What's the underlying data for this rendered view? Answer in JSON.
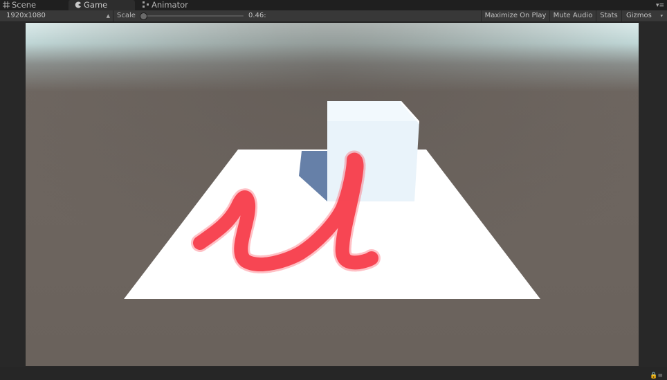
{
  "tabs": [
    {
      "label": "Scene",
      "icon": "grid-icon"
    },
    {
      "label": "Game",
      "icon": "pacman-icon"
    },
    {
      "label": "Animator",
      "icon": "animator-icon"
    }
  ],
  "active_tab": "Game",
  "toolbar": {
    "resolution": "1920x1080",
    "scale_label": "Scale",
    "scale_value": "0.46:",
    "scale_fraction": 0.46,
    "maximize_label": "Maximize On Play",
    "mute_label": "Mute Audio",
    "stats_label": "Stats",
    "gizmos_label": "Gizmos"
  },
  "colors": {
    "sky": "#d8f0f0",
    "ground": "#6c645e",
    "plane": "#ffffff",
    "cube": "#eef6fb",
    "shadow": "#6680a8",
    "paint": "#f23a48"
  }
}
